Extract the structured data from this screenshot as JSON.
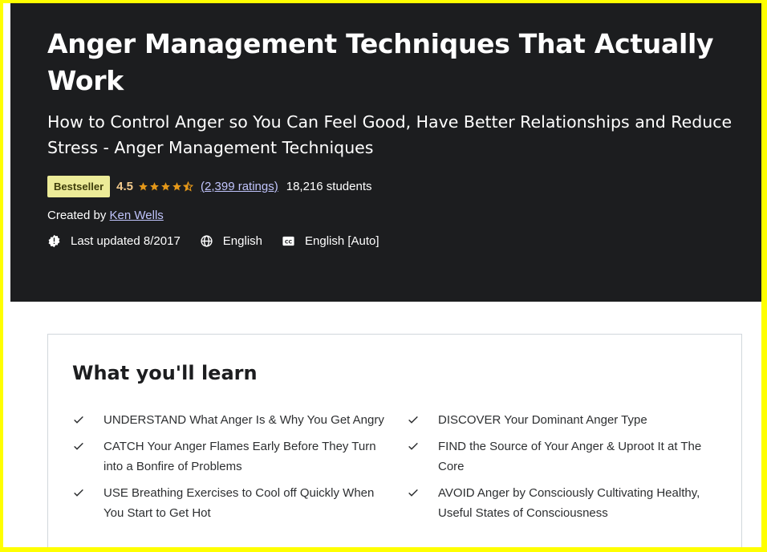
{
  "course": {
    "title": "Anger Management Techniques That Actually Work",
    "subtitle": "How to Control Anger so You Can Feel Good, Have Better Relationships and Reduce Stress - Anger Management Techniques",
    "badge": "Bestseller",
    "rating": "4.5",
    "rating_value": 4.5,
    "rating_max": 5,
    "ratings_count": "(2,399 ratings)",
    "students": "18,216 students",
    "created_by_label": "Created by",
    "instructor": "Ken Wells",
    "last_updated": "Last updated 8/2017",
    "language": "English",
    "captions": "English [Auto]"
  },
  "learn": {
    "heading": "What you'll learn",
    "items": [
      "UNDERSTAND What Anger Is & Why You Get Angry",
      "DISCOVER Your Dominant Anger Type",
      "CATCH Your Anger Flames Early Before They Turn into a Bonfire of Problems",
      "FIND the Source of Your Anger & Uproot It at The Core",
      "USE Breathing Exercises to Cool off Quickly When You Start to Get Hot",
      "AVOID Anger by Consciously Cultivating Healthy, Useful States of Consciousness"
    ]
  },
  "colors": {
    "hero_bg": "#1c1d1f",
    "badge_bg": "#eceb98",
    "star": "#f3ca8c",
    "link": "#c0c4fc",
    "frame": "#ffff00"
  },
  "icons": [
    "star-icon",
    "half-star-icon",
    "alert-badge-icon",
    "globe-icon",
    "closed-captions-icon",
    "check-icon"
  ]
}
